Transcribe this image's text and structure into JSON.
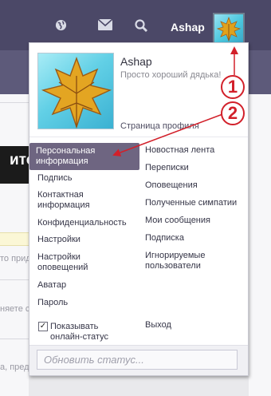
{
  "header": {
    "username": "Ashap",
    "icons": [
      "globe-icon",
      "mail-icon",
      "search-icon"
    ]
  },
  "background": {
    "fragments": [
      "итор",
      "то прид",
      "няете с",
      "а, пред"
    ]
  },
  "popup": {
    "name": "Ashap",
    "status_text": "Просто хороший дядька!",
    "profile_link": "Страница профиля",
    "left_menu": [
      "Персональная информация",
      "Подпись",
      "Контактная информация",
      "Конфиденциальность",
      "Настройки",
      "Настройки оповещений",
      "Аватар",
      "Пароль"
    ],
    "right_menu": [
      "Новостная лента",
      "Переписки",
      "Оповещения",
      "Полученные симпатии",
      "Мои сообщения",
      "Подписка",
      "Игнорируемые пользователи"
    ],
    "show_online_label": "Показывать онлайн-статус",
    "show_online_checked": true,
    "logout_label": "Выход",
    "status_placeholder": "Обновить статус..."
  },
  "annotations": {
    "marker_1": "1",
    "marker_2": "2",
    "color": "#d2202a"
  },
  "colors": {
    "topbar": "#4b4867",
    "active_item": "#6e6581"
  }
}
